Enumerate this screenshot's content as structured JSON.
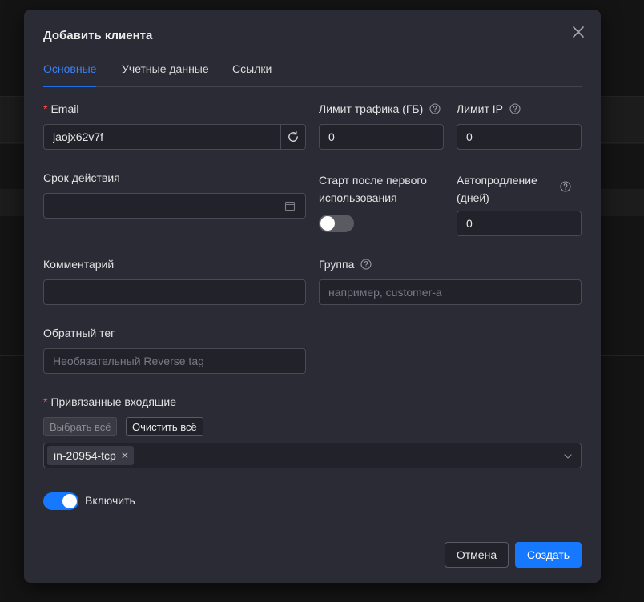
{
  "modal": {
    "title": "Добавить клиента"
  },
  "tabs": [
    {
      "label": "Основные",
      "active": true
    },
    {
      "label": "Учетные данные",
      "active": false
    },
    {
      "label": "Ссылки",
      "active": false
    }
  ],
  "form": {
    "email": {
      "label": "Email",
      "required": true,
      "value": "jaojx62v7f"
    },
    "traffic_limit": {
      "label": "Лимит трафика (ГБ)",
      "value": "0"
    },
    "ip_limit": {
      "label": "Лимит IP",
      "value": "0"
    },
    "expiry": {
      "label": "Срок действия",
      "value": ""
    },
    "start_after_first_use": {
      "label_line1": "Старт после первого",
      "label_line2": "использования",
      "enabled": false
    },
    "auto_renew": {
      "label_line1": "Автопродление",
      "label_line2": "(дней)",
      "value": "0"
    },
    "comment": {
      "label": "Комментарий",
      "value": ""
    },
    "group": {
      "label": "Группа",
      "placeholder": "например, customer-a"
    },
    "reverse_tag": {
      "label": "Обратный тег",
      "placeholder": "Необязательный Reverse tag"
    },
    "inbounds": {
      "label": "Привязанные входящие",
      "required": true,
      "select_all_label": "Выбрать всё",
      "clear_all_label": "Очистить всё",
      "selected": [
        "in-20954-tcp"
      ]
    },
    "enable": {
      "label": "Включить",
      "enabled": true
    }
  },
  "footer": {
    "cancel_label": "Отмена",
    "create_label": "Создать"
  },
  "colors": {
    "accent": "#1677ff",
    "required": "#ff4d4f",
    "modal_bg": "#2b2b35"
  }
}
